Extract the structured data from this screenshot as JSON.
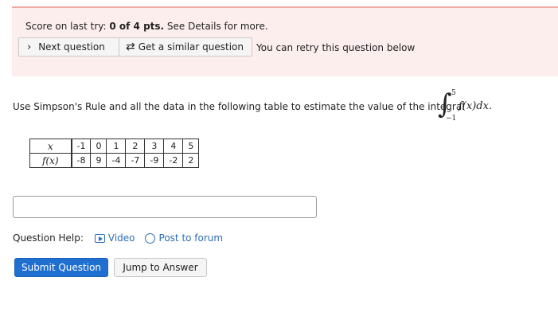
{
  "score": {
    "prefix": "Score on last try: ",
    "value": "0 of 4 pts.",
    "suffix": " See Details for more."
  },
  "actions": {
    "next_label": "Next question",
    "similar_label": "Get a similar question",
    "retry_text": "You can retry this question below"
  },
  "question": {
    "text": "Use Simpson's Rule and all the data in the following table to estimate the value of the integral",
    "integral_upper": "5",
    "integral_lower": "−1",
    "integrand": "f(x)dx."
  },
  "table": {
    "x_header": "x",
    "fx_header": "f(x)",
    "x_values": [
      "-1",
      "0",
      "1",
      "2",
      "3",
      "4",
      "5"
    ],
    "fx_values": [
      "-8",
      "9",
      "-4",
      "-7",
      "-9",
      "-2",
      "2"
    ]
  },
  "answer": {
    "value": ""
  },
  "help": {
    "label": "Question Help:",
    "video_label": "Video",
    "forum_label": "Post to forum"
  },
  "buttons": {
    "submit_label": "Submit Question",
    "jump_label": "Jump to Answer"
  },
  "colors": {
    "panel_bg": "#fdeeee",
    "panel_border": "#f0a9a9",
    "link": "#2c6cb8",
    "submit_bg": "#1f6fd1"
  }
}
